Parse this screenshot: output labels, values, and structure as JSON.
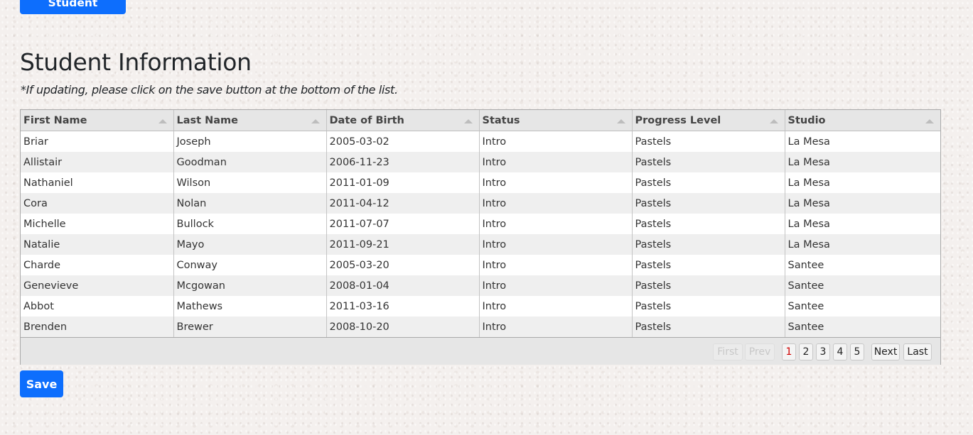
{
  "buttons": {
    "register": "Register Student",
    "save": "Save"
  },
  "title": "Student Information",
  "note": "*If updating, please click on the save button at the bottom of the list.",
  "table": {
    "columns": [
      "First Name",
      "Last Name",
      "Date of Birth",
      "Status",
      "Progress Level",
      "Studio"
    ],
    "rows": [
      [
        "Briar",
        "Joseph",
        "2005-03-02",
        "Intro",
        "Pastels",
        "La Mesa"
      ],
      [
        "Allistair",
        "Goodman",
        "2006-11-23",
        "Intro",
        "Pastels",
        "La Mesa"
      ],
      [
        "Nathaniel",
        "Wilson",
        "2011-01-09",
        "Intro",
        "Pastels",
        "La Mesa"
      ],
      [
        "Cora",
        "Nolan",
        "2011-04-12",
        "Intro",
        "Pastels",
        "La Mesa"
      ],
      [
        "Michelle",
        "Bullock",
        "2011-07-07",
        "Intro",
        "Pastels",
        "La Mesa"
      ],
      [
        "Natalie",
        "Mayo",
        "2011-09-21",
        "Intro",
        "Pastels",
        "La Mesa"
      ],
      [
        "Charde",
        "Conway",
        "2005-03-20",
        "Intro",
        "Pastels",
        "Santee"
      ],
      [
        "Genevieve",
        "Mcgowan",
        "2008-01-04",
        "Intro",
        "Pastels",
        "Santee"
      ],
      [
        "Abbot",
        "Mathews",
        "2011-03-16",
        "Intro",
        "Pastels",
        "Santee"
      ],
      [
        "Brenden",
        "Brewer",
        "2008-10-20",
        "Intro",
        "Pastels",
        "Santee"
      ]
    ]
  },
  "pagination": {
    "first": "First",
    "prev": "Prev",
    "pages": [
      "1",
      "2",
      "3",
      "4",
      "5"
    ],
    "current_page": "1",
    "next": "Next",
    "last": "Last"
  },
  "colors": {
    "accent": "#0d6efd",
    "current_page": "#d00000"
  },
  "icons": [
    "sort-ascending-icon"
  ]
}
